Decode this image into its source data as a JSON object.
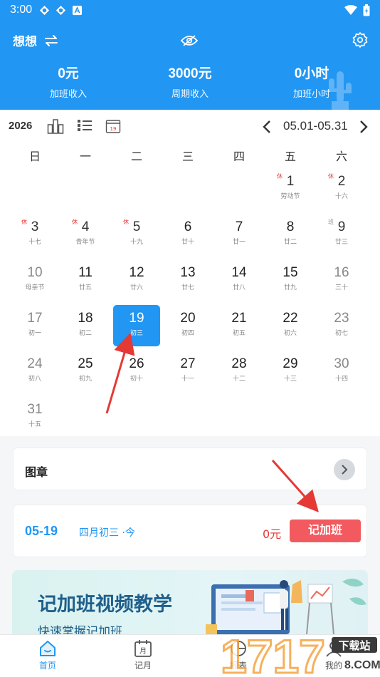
{
  "status_bar": {
    "time": "3:00"
  },
  "header": {
    "title": "想想",
    "stats": [
      {
        "value": "0元",
        "label": "加班收入"
      },
      {
        "value": "3000元",
        "label": "周期收入"
      },
      {
        "value": "0小时",
        "label": "加班小时"
      }
    ]
  },
  "toolbar": {
    "year": "2026",
    "range": "05.01-05.31"
  },
  "calendar": {
    "weekdays": [
      "日",
      "一",
      "二",
      "三",
      "四",
      "五",
      "六"
    ],
    "days": [
      {
        "n": "1",
        "sub": "劳动节",
        "tag": "休"
      },
      {
        "n": "2",
        "sub": "十六",
        "tag": "休"
      },
      {
        "n": "3",
        "sub": "十七",
        "tag": "休"
      },
      {
        "n": "4",
        "sub": "青年节",
        "tag": "休"
      },
      {
        "n": "5",
        "sub": "十九",
        "tag": "休"
      },
      {
        "n": "6",
        "sub": "廿十"
      },
      {
        "n": "7",
        "sub": "廿一"
      },
      {
        "n": "8",
        "sub": "廿二"
      },
      {
        "n": "9",
        "sub": "廿三",
        "tag": "班"
      },
      {
        "n": "10",
        "sub": "母亲节"
      },
      {
        "n": "11",
        "sub": "廿五"
      },
      {
        "n": "12",
        "sub": "廿六"
      },
      {
        "n": "13",
        "sub": "廿七"
      },
      {
        "n": "14",
        "sub": "廿八"
      },
      {
        "n": "15",
        "sub": "廿九"
      },
      {
        "n": "16",
        "sub": "三十"
      },
      {
        "n": "17",
        "sub": "初一"
      },
      {
        "n": "18",
        "sub": "初二"
      },
      {
        "n": "19",
        "sub": "初三",
        "selected": true
      },
      {
        "n": "20",
        "sub": "初四"
      },
      {
        "n": "21",
        "sub": "初五"
      },
      {
        "n": "22",
        "sub": "初六"
      },
      {
        "n": "23",
        "sub": "初七"
      },
      {
        "n": "24",
        "sub": "初八"
      },
      {
        "n": "25",
        "sub": "初九"
      },
      {
        "n": "26",
        "sub": "初十"
      },
      {
        "n": "27",
        "sub": "十一"
      },
      {
        "n": "28",
        "sub": "十二"
      },
      {
        "n": "29",
        "sub": "十三"
      },
      {
        "n": "30",
        "sub": "十四"
      },
      {
        "n": "31",
        "sub": "十五"
      }
    ]
  },
  "seal_card": {
    "label": "图章"
  },
  "record_card": {
    "date": "05-19",
    "lunar": "四月初三 ·今",
    "amount": "0元",
    "button": "记加班"
  },
  "banner": {
    "title": "记加班视频教学",
    "subtitle": "快速掌握记加班"
  },
  "bottom_nav": [
    {
      "label": "首页",
      "icon": "home-icon",
      "active": true
    },
    {
      "label": "记月",
      "icon": "calendar-month-icon"
    },
    {
      "label": "报表",
      "icon": "report-icon"
    },
    {
      "label": "我的",
      "icon": "profile-icon"
    }
  ],
  "watermark": {
    "text": "1717",
    "tag": "下载站",
    "url": "8.COM"
  },
  "colors": {
    "primary": "#2196f3",
    "accent_red": "#f25a5f",
    "holiday_red": "#e53935"
  }
}
